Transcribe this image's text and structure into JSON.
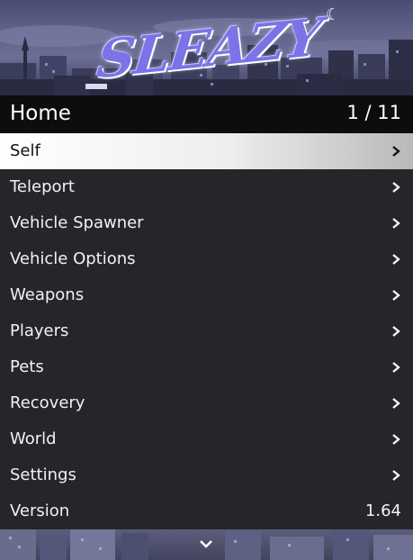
{
  "banner": {
    "logo_text": "SLEAZY",
    "moon_glyph": "☾"
  },
  "header": {
    "title": "Home",
    "counter": "1 / 11"
  },
  "menu": {
    "items": [
      {
        "label": "Self",
        "selected": true
      },
      {
        "label": "Teleport"
      },
      {
        "label": "Vehicle Spawner"
      },
      {
        "label": "Vehicle Options"
      },
      {
        "label": "Weapons"
      },
      {
        "label": "Players"
      },
      {
        "label": "Pets"
      },
      {
        "label": "Recovery"
      },
      {
        "label": "World"
      },
      {
        "label": "Settings"
      },
      {
        "label": "Version",
        "value": "1.64"
      }
    ]
  },
  "colors": {
    "accent_logo": "#7b74e8",
    "menu_bg": "#26262a",
    "header_bg": "#0d0d10",
    "selected_bg": "#ffffff"
  }
}
